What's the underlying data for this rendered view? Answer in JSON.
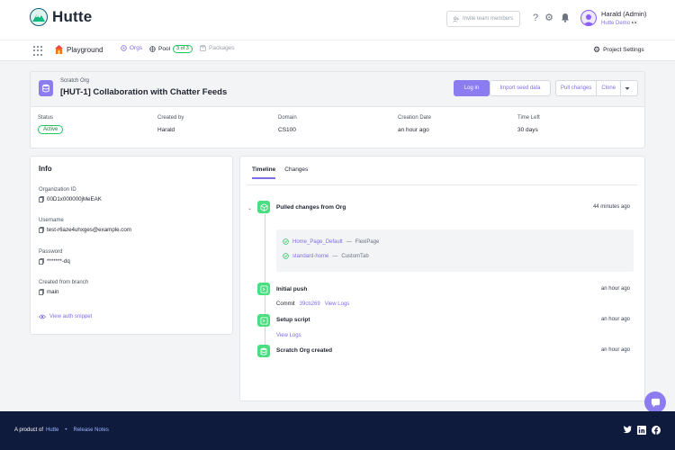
{
  "app": {
    "brand": "Hutte",
    "accent": "#8b7cf0",
    "success": "#22c55e"
  },
  "header": {
    "invite_placeholder": "Invite team members",
    "user_name": "Harald (Admin)",
    "user_org": "Hutte Demo 👀"
  },
  "nav": {
    "playground": "Playground",
    "orgs": "Orgs",
    "pool": "Pool",
    "pool_badge": "3 of 3",
    "packages": "Packages",
    "project_settings": "Project Settings"
  },
  "org": {
    "kind": "Scratch Org",
    "title": "[HUT-1] Collaboration with Chatter Feeds",
    "buttons": {
      "login": "Log in",
      "import_seed": "Import seed data",
      "pull": "Pull changes",
      "clone": "Clone"
    },
    "details": {
      "status_label": "Status",
      "status_value": "Active",
      "created_by_label": "Created by",
      "created_by_value": "Harald",
      "domain_label": "Domain",
      "domain_value": "CS100",
      "creation_label": "Creation Date",
      "creation_value": "an hour ago",
      "timeleft_label": "Time Left",
      "timeleft_value": "30 days"
    }
  },
  "info": {
    "title": "Info",
    "org_id_label": "Organization ID",
    "org_id_value": "00D1x000000jMeEAK",
    "username_label": "Username",
    "username_value": "test-r6aze4uhxges@example.com",
    "password_label": "Password",
    "password_value": "*******-dq",
    "branch_label": "Created from branch",
    "branch_value": "main",
    "auth_snippet": "View auth snippet"
  },
  "timeline": {
    "tabs": [
      "Timeline",
      "Changes"
    ],
    "events": [
      {
        "title": "Pulled changes from Org",
        "time": "44 minutes ago"
      },
      {
        "title": "Initial push",
        "time": "an hour ago"
      },
      {
        "title": "Setup script",
        "time": "an hour ago"
      },
      {
        "title": "Scratch Org created",
        "time": "an hour ago"
      }
    ],
    "changes": [
      {
        "name": "Home_Page_Default",
        "type": "FlexiPage"
      },
      {
        "name": "standard-home",
        "type": "CustomTab"
      }
    ],
    "commit_label": "Commit",
    "commit_hash": "39cb269",
    "view_logs": "View Logs"
  },
  "footer": {
    "product_of": "A product of",
    "brand": "Hutte",
    "dot": "•",
    "release_notes": "Release Notes"
  }
}
